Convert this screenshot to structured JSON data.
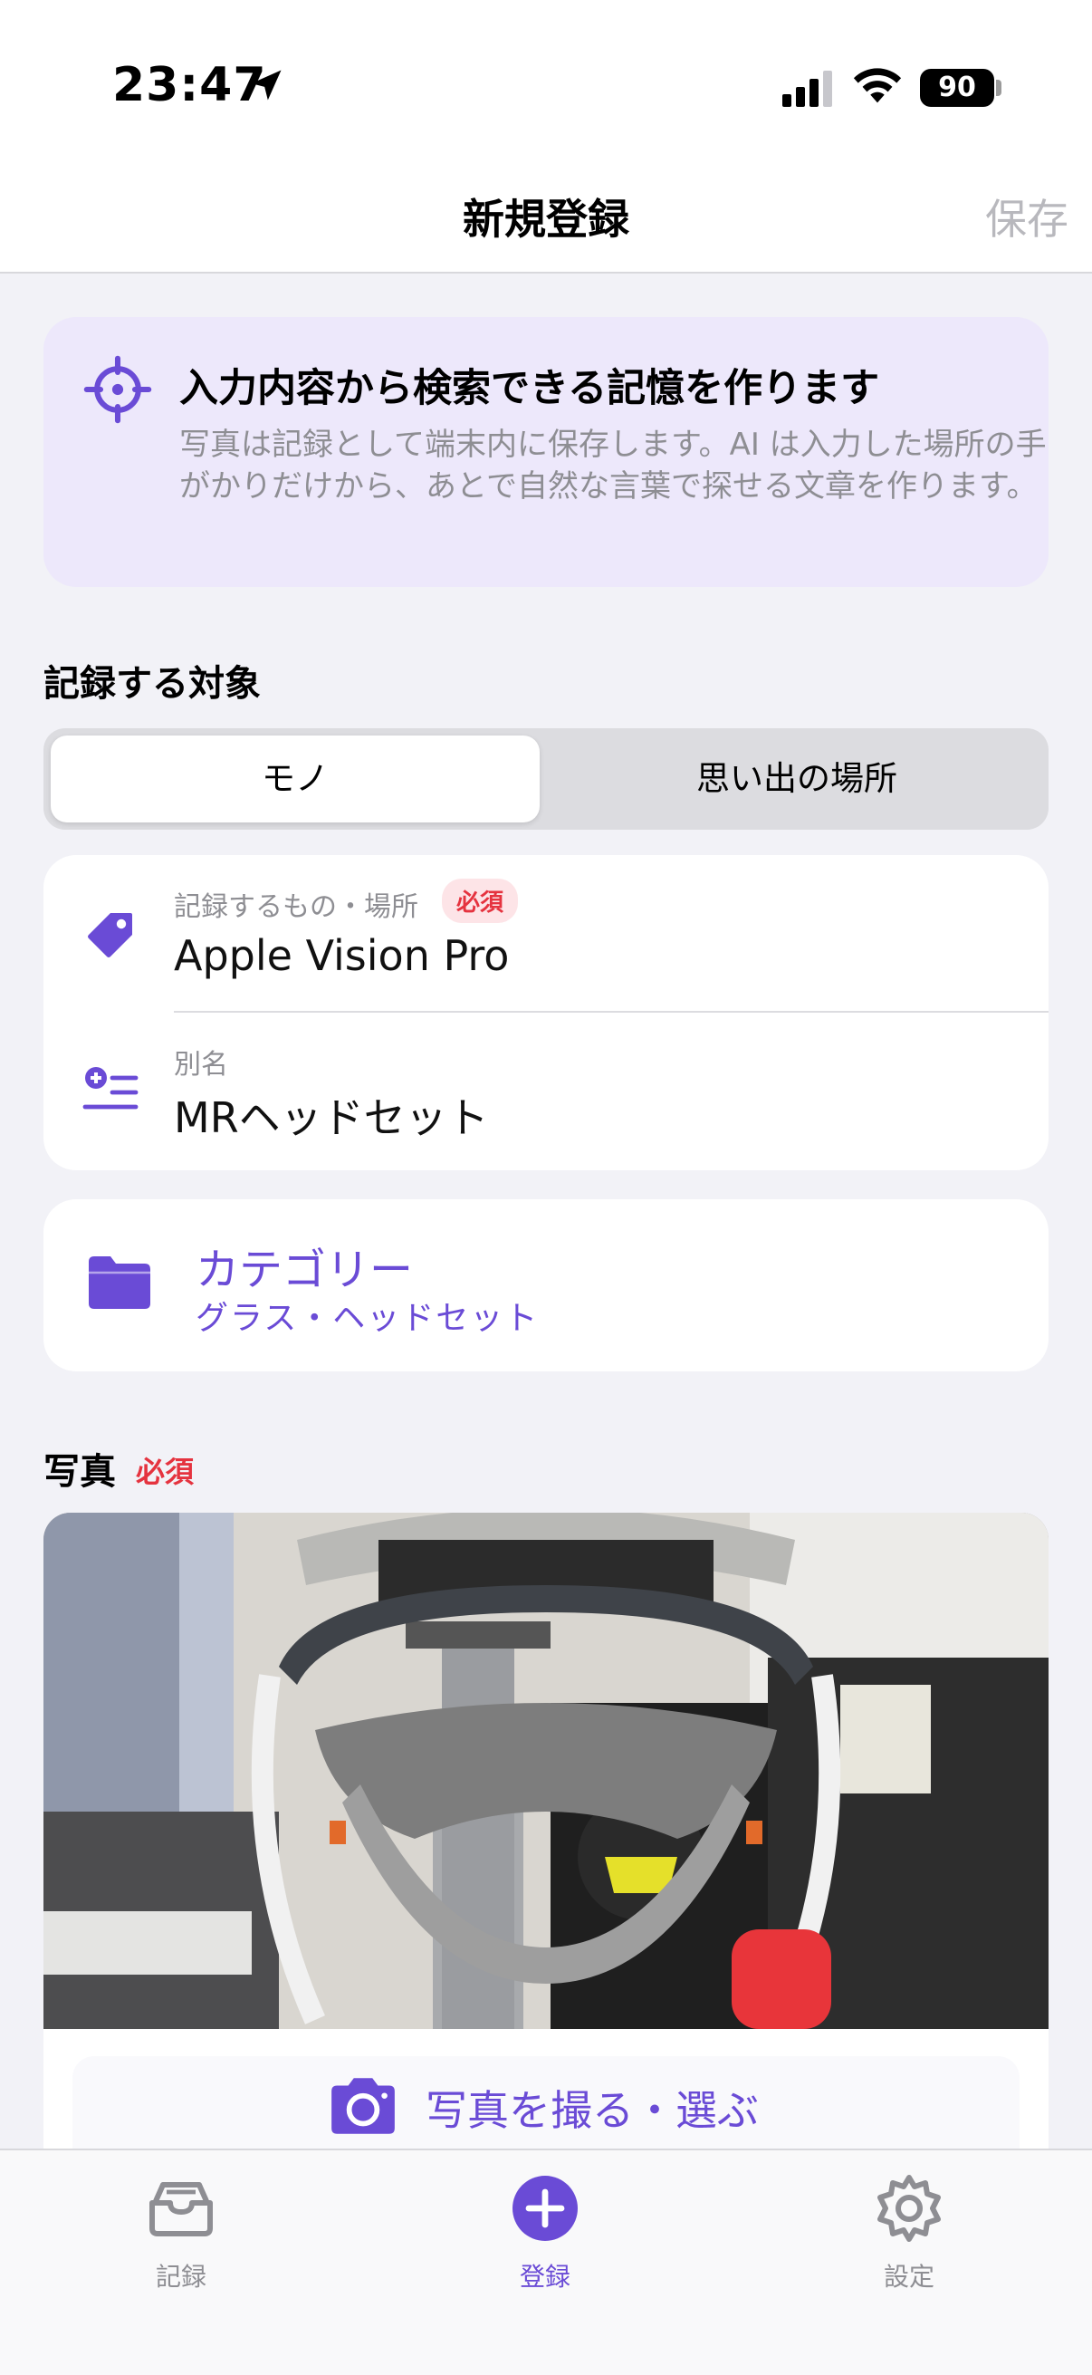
{
  "status": {
    "time": "23:47",
    "battery": "90",
    "icons": [
      "location-arrow-icon",
      "cellular-signal-icon",
      "wifi-icon",
      "battery-icon"
    ]
  },
  "nav": {
    "title": "新規登録",
    "save_label": "保存"
  },
  "banner": {
    "icon": "crosshair-icon",
    "title": "入力内容から検索できる記憶を作ります",
    "text": "写真は記録として端末内に保存します。AI は入力した場所の手がかりだけから、あとで自然な言葉で探せる文章を作ります。"
  },
  "target_section": {
    "label": "記録する対象",
    "options": [
      "モノ",
      "思い出の場所"
    ],
    "selected": "モノ"
  },
  "fields": {
    "name": {
      "icon": "tag-icon",
      "label": "記録するもの・場所",
      "required_badge": "必須",
      "value": "Apple Vision Pro"
    },
    "alias": {
      "icon": "add-list-icon",
      "label": "別名",
      "value": "MRヘッドセット"
    }
  },
  "category": {
    "icon": "folder-icon",
    "title": "カテゴリー",
    "value": "グラス・ヘッドセット"
  },
  "photo_section": {
    "label": "写真",
    "required": "必須",
    "cta_label": "写真を撮る・選ぶ",
    "cta_icon": "camera-icon"
  },
  "tabbar": {
    "items": [
      {
        "label": "記録",
        "icon": "tray-icon"
      },
      {
        "label": "登録",
        "icon": "plus-circle-icon"
      },
      {
        "label": "設定",
        "icon": "gear-icon"
      }
    ],
    "active": "登録"
  },
  "colors": {
    "accent": "#6a4bd6",
    "banner_bg": "#ede8fb",
    "required_red": "#e5333f",
    "page_bg": "#f2f2f7"
  }
}
